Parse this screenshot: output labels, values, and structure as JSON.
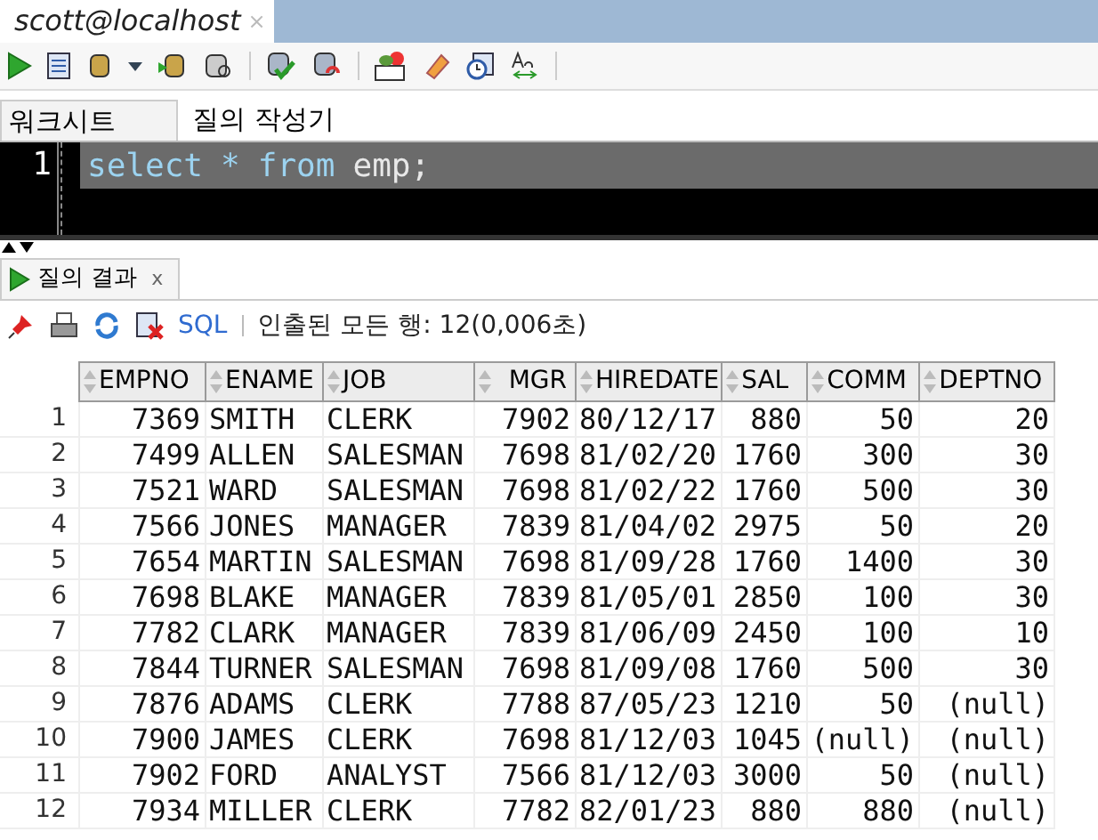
{
  "editor_tab": {
    "title": "scott@localhost",
    "close": "×"
  },
  "worksheet_tabs": [
    {
      "label": "워크시트",
      "selected": true
    },
    {
      "label": "질의 작성기",
      "selected": false
    }
  ],
  "editor": {
    "line_number": "1",
    "tokens": [
      {
        "text": "select",
        "kind": "keyword"
      },
      {
        "text": "*",
        "kind": "operator"
      },
      {
        "text": "from",
        "kind": "keyword"
      },
      {
        "text": "emp;",
        "kind": "plain"
      }
    ],
    "selected": true
  },
  "results_tab": {
    "label": "질의 결과",
    "close": "x"
  },
  "results_toolbar": {
    "sql_link": "SQL",
    "status": "인출된 모든 행: 12(0,006초)"
  },
  "table": {
    "columns": [
      {
        "label": "EMPNO",
        "kind": "number"
      },
      {
        "label": "ENAME",
        "kind": "text"
      },
      {
        "label": "JOB",
        "kind": "text"
      },
      {
        "label": "MGR",
        "kind": "number"
      },
      {
        "label": "HIREDATE",
        "kind": "text"
      },
      {
        "label": "SAL",
        "kind": "number"
      },
      {
        "label": "COMM",
        "kind": "number"
      },
      {
        "label": "DEPTNO",
        "kind": "number"
      }
    ],
    "rows": [
      {
        "row_number": "1",
        "cells": [
          "7369",
          "SMITH",
          "CLERK",
          "7902",
          "80/12/17",
          "880",
          "50",
          "20"
        ]
      },
      {
        "row_number": "2",
        "cells": [
          "7499",
          "ALLEN",
          "SALESMAN",
          "7698",
          "81/02/20",
          "1760",
          "300",
          "30"
        ]
      },
      {
        "row_number": "3",
        "cells": [
          "7521",
          "WARD",
          "SALESMAN",
          "7698",
          "81/02/22",
          "1760",
          "500",
          "30"
        ]
      },
      {
        "row_number": "4",
        "cells": [
          "7566",
          "JONES",
          "MANAGER",
          "7839",
          "81/04/02",
          "2975",
          "50",
          "20"
        ]
      },
      {
        "row_number": "5",
        "cells": [
          "7654",
          "MARTIN",
          "SALESMAN",
          "7698",
          "81/09/28",
          "1760",
          "1400",
          "30"
        ]
      },
      {
        "row_number": "6",
        "cells": [
          "7698",
          "BLAKE",
          "MANAGER",
          "7839",
          "81/05/01",
          "2850",
          "100",
          "30"
        ]
      },
      {
        "row_number": "7",
        "cells": [
          "7782",
          "CLARK",
          "MANAGER",
          "7839",
          "81/06/09",
          "2450",
          "100",
          "10"
        ]
      },
      {
        "row_number": "8",
        "cells": [
          "7844",
          "TURNER",
          "SALESMAN",
          "7698",
          "81/09/08",
          "1760",
          "500",
          "30"
        ]
      },
      {
        "row_number": "9",
        "cells": [
          "7876",
          "ADAMS",
          "CLERK",
          "7788",
          "87/05/23",
          "1210",
          "50",
          "(null)"
        ]
      },
      {
        "row_number": "10",
        "cells": [
          "7900",
          "JAMES",
          "CLERK",
          "7698",
          "81/12/03",
          "1045",
          "(null)",
          "(null)"
        ]
      },
      {
        "row_number": "11",
        "cells": [
          "7902",
          "FORD",
          "ANALYST",
          "7566",
          "81/12/03",
          "3000",
          "50",
          "(null)"
        ]
      },
      {
        "row_number": "12",
        "cells": [
          "7934",
          "MILLER",
          "CLERK",
          "7782",
          "82/01/23",
          "880",
          "880",
          "(null)"
        ]
      }
    ]
  }
}
